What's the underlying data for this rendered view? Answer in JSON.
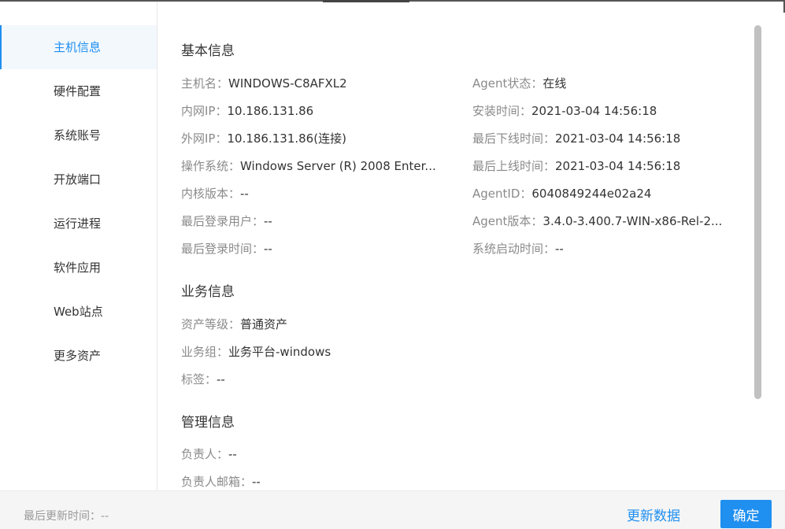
{
  "sidebar": {
    "items": [
      {
        "label": "主机信息",
        "active": true
      },
      {
        "label": "硬件配置"
      },
      {
        "label": "系统账号"
      },
      {
        "label": "开放端口"
      },
      {
        "label": "运行进程"
      },
      {
        "label": "软件应用"
      },
      {
        "label": "Web站点"
      },
      {
        "label": "更多资产"
      }
    ]
  },
  "basic": {
    "title": "基本信息",
    "left": [
      {
        "k": "主机名：",
        "v": "WINDOWS-C8AFXL2"
      },
      {
        "k": "内网IP：",
        "v": "10.186.131.86"
      },
      {
        "k": "外网IP：",
        "v": "10.186.131.86(连接)"
      },
      {
        "k": "操作系统：",
        "v": "Windows Server (R) 2008 Enter..."
      },
      {
        "k": "内核版本：",
        "v": "--"
      },
      {
        "k": "最后登录用户：",
        "v": "--"
      },
      {
        "k": "最后登录时间：",
        "v": "--"
      }
    ],
    "right": [
      {
        "k": "Agent状态：",
        "v": "在线"
      },
      {
        "k": "安装时间：",
        "v": "2021-03-04 14:56:18"
      },
      {
        "k": "最后下线时间：",
        "v": "2021-03-04 14:56:18"
      },
      {
        "k": "最后上线时间：",
        "v": "2021-03-04 14:56:18"
      },
      {
        "k": "AgentID：",
        "v": "6040849244e02a24"
      },
      {
        "k": "Agent版本：",
        "v": "3.4.0-3.400.7-WIN-x86-Rel-2..."
      },
      {
        "k": "系统启动时间：",
        "v": "--"
      }
    ]
  },
  "business": {
    "title": "业务信息",
    "rows": [
      {
        "k": "资产等级：",
        "v": "普通资产"
      },
      {
        "k": "业务组：",
        "v": "业务平台-windows"
      },
      {
        "k": "标签：",
        "v": "--"
      }
    ]
  },
  "management": {
    "title": "管理信息",
    "rows": [
      {
        "k": "负责人：",
        "v": "--"
      },
      {
        "k": "负责人邮箱：",
        "v": "--"
      }
    ]
  },
  "footer": {
    "last_update": "最后更新时间：--",
    "refresh_label": "更新数据",
    "ok_label": "确定"
  },
  "colors": {
    "accent": "#1f8ff0"
  }
}
